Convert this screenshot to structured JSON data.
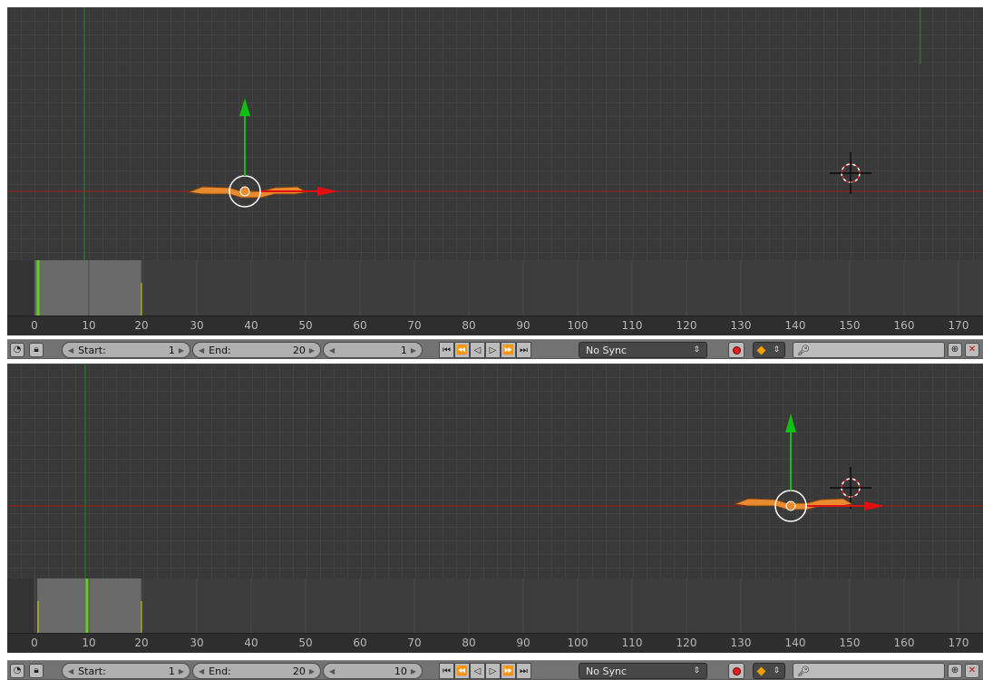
{
  "editors": [
    {
      "timeline": {
        "ticks": [
          "0",
          "10",
          "20",
          "30",
          "40",
          "50",
          "60",
          "70",
          "80",
          "90",
          "100",
          "110",
          "120",
          "130",
          "140",
          "150",
          "160",
          "170"
        ],
        "current_frame_marker": 1
      },
      "header": {
        "start_label": "Start:",
        "start_value": "1",
        "end_label": "End:",
        "end_value": "20",
        "current_frame": "1",
        "sync_mode": "No Sync",
        "play_icons": [
          "jump-to-start-icon",
          "previous-keyframe-icon",
          "play-reverse-icon",
          "play-icon",
          "next-keyframe-icon",
          "jump-to-end-icon"
        ]
      }
    },
    {
      "timeline": {
        "ticks": [
          "0",
          "10",
          "20",
          "30",
          "40",
          "50",
          "60",
          "70",
          "80",
          "90",
          "100",
          "110",
          "120",
          "130",
          "140",
          "150",
          "160",
          "170"
        ],
        "current_frame_marker": 10
      },
      "header": {
        "start_label": "Start:",
        "start_value": "1",
        "end_label": "End:",
        "end_value": "20",
        "current_frame": "10",
        "sync_mode": "No Sync",
        "play_icons": [
          "jump-to-start-icon",
          "previous-keyframe-icon",
          "play-reverse-icon",
          "play-icon",
          "next-keyframe-icon",
          "jump-to-end-icon"
        ]
      }
    }
  ],
  "colors": {
    "viewport_bg": "#393939",
    "x_axis": "#c02020",
    "y_axis": "#1a8f1a",
    "gizmo_x": "#e01010",
    "gizmo_y": "#10c010",
    "playhead": "#5fd020",
    "range_marker": "#d8d000",
    "armature": "#e88a30"
  }
}
